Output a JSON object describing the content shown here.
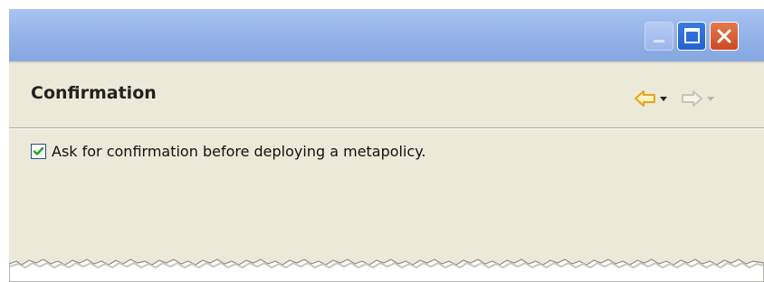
{
  "window": {
    "title_buttons": {
      "minimize_icon": "minimize-icon",
      "maximize_icon": "maximize-icon",
      "close_icon": "close-icon"
    }
  },
  "header": {
    "title": "Confirmation",
    "nav": {
      "back_icon": "arrow-left-icon",
      "forward_icon": "arrow-right-icon",
      "dropdown_icon": "chevron-down-icon"
    }
  },
  "options": [
    {
      "label": "Ask for confirmation before deploying a metapolicy.",
      "checked": true
    }
  ],
  "colors": {
    "panel_bg": "#ece9d8",
    "titlebar": "#9ab8ec",
    "back_arrow": "#e8a317",
    "forward_arrow_disabled": "#c7c5b8",
    "close_button": "#d6552b",
    "maximize_button": "#2d6ad9",
    "checkmark": "#21a121"
  }
}
